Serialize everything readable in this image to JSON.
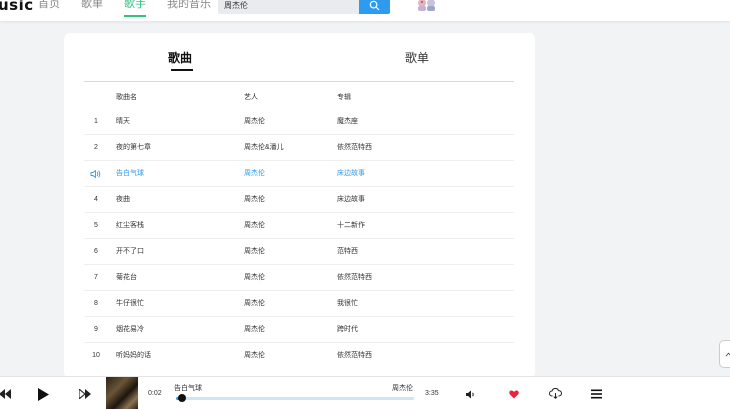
{
  "header": {
    "logo_text": "usic",
    "nav": [
      {
        "label": "首页",
        "active": false
      },
      {
        "label": "歌单",
        "active": false
      },
      {
        "label": "歌手",
        "active": true
      },
      {
        "label": "我的音乐",
        "active": false
      }
    ],
    "search": {
      "value": "周杰伦"
    },
    "icons": {
      "search": "search-icon",
      "avatar": "avatar-icon"
    }
  },
  "tabs": [
    {
      "label": "歌曲",
      "active": true
    },
    {
      "label": "歌单",
      "active": false
    }
  ],
  "table": {
    "headers": {
      "name": "歌曲名",
      "artist": "艺人",
      "album": "专辑"
    },
    "rows": [
      {
        "index": "1",
        "name": "晴天",
        "artist": "周杰伦",
        "album": "魔杰座",
        "playing": false
      },
      {
        "index": "2",
        "name": "夜的第七章",
        "artist": "周杰伦&潘儿",
        "album": "依然范特西",
        "playing": false
      },
      {
        "index": "",
        "name": "告白气球",
        "artist": "周杰伦",
        "album": "床边故事",
        "playing": true
      },
      {
        "index": "4",
        "name": "夜曲",
        "artist": "周杰伦",
        "album": "床边故事",
        "playing": false
      },
      {
        "index": "5",
        "name": "红尘客栈",
        "artist": "周杰伦",
        "album": "十二新作",
        "playing": false
      },
      {
        "index": "6",
        "name": "开不了口",
        "artist": "周杰伦",
        "album": "范特西",
        "playing": false
      },
      {
        "index": "7",
        "name": "菊花台",
        "artist": "周杰伦",
        "album": "依然范特西",
        "playing": false
      },
      {
        "index": "8",
        "name": "牛仔很忙",
        "artist": "周杰伦",
        "album": "我很忙",
        "playing": false
      },
      {
        "index": "9",
        "name": "烟花易冷",
        "artist": "周杰伦",
        "album": "跨时代",
        "playing": false
      },
      {
        "index": "10",
        "name": "听妈妈的话",
        "artist": "周杰伦",
        "album": "依然范特西",
        "playing": false
      }
    ]
  },
  "player": {
    "current_time": "0:02",
    "total_time": "3:35",
    "title": "告白气球",
    "artist": "周杰伦",
    "progress_fraction": 0.01,
    "colors": {
      "accent": "#2f9bee",
      "heart": "#e8243c",
      "nav_active": "#31c27c"
    },
    "icons": [
      "prev-icon",
      "play-icon",
      "next-icon",
      "volume-icon",
      "heart-icon",
      "download-icon",
      "playlist-icon"
    ]
  }
}
